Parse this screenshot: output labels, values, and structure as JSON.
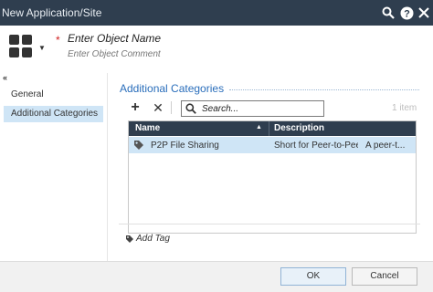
{
  "window": {
    "title": "New Application/Site",
    "icons": {
      "search": "search-icon",
      "help": "help-icon",
      "close": "close-icon"
    }
  },
  "header": {
    "object_icon": "application-grid-icon",
    "required_marker": "*",
    "name_placeholder": "Enter Object Name",
    "comment_placeholder": "Enter Object Comment"
  },
  "sidebar": {
    "collapse_label": "«",
    "items": [
      {
        "label": "General",
        "selected": false
      },
      {
        "label": "Additional Categories",
        "selected": true
      }
    ]
  },
  "main": {
    "section_title": "Additional Categories",
    "toolbar": {
      "add_label": "+",
      "remove_label": "✕",
      "search_placeholder": "Search...",
      "item_count": "1 item"
    },
    "grid": {
      "columns": [
        "Name",
        "Description"
      ],
      "sort_indicator": "▲",
      "rows": [
        {
          "icon": "category-tag-icon",
          "name": "P2P File Sharing",
          "description": "Short for Peer-to-Peer.",
          "description_extra": "A peer-t..."
        }
      ]
    },
    "add_tag_label": "Add Tag"
  },
  "footer": {
    "ok_label": "OK",
    "cancel_label": "Cancel"
  },
  "colors": {
    "titlebar": "#2f3e4f",
    "selection": "#cfe5f6",
    "accent": "#2a6ebb",
    "required": "#d02020"
  }
}
